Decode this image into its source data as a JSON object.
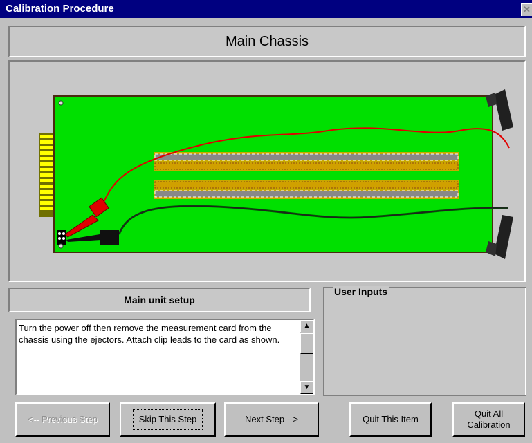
{
  "window": {
    "title": "Calibration Procedure",
    "close_glyph": "✕"
  },
  "header": {
    "title": "Main Chassis"
  },
  "step": {
    "title": "Main unit setup",
    "instructions": "Turn the power off then remove the measurement card from the chassis using the ejectors. Attach clip leads to the card as shown."
  },
  "user_inputs": {
    "label": "User Inputs"
  },
  "buttons": {
    "previous": "<-- Previous Step",
    "skip": "Skip This Step",
    "next": "Next Step -->",
    "quit_item": "Quit This Item",
    "quit_all": "Quit All\nCalibration"
  },
  "colors": {
    "board": "#00e000",
    "titlebar": "#000080",
    "red_lead": "#e00000"
  }
}
